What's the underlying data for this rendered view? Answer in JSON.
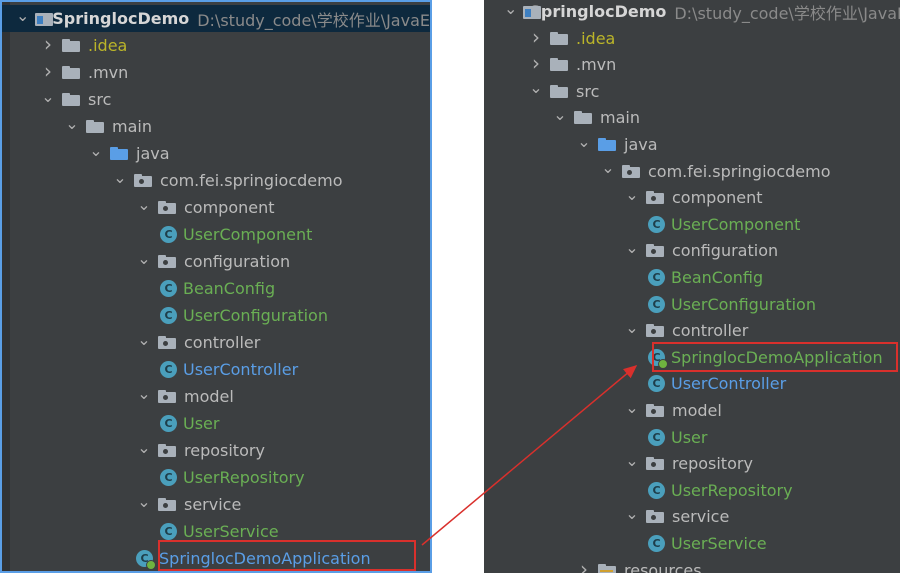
{
  "project": {
    "name": "SpringlocDemo",
    "path": "D:\\study_code\\学校作业\\JavaE"
  },
  "left_tree": [
    {
      "label": "SpringlocDemo",
      "type": "project",
      "depth": 0,
      "arrow": "down",
      "style": "bold"
    },
    {
      "label": ".idea",
      "type": "folder",
      "depth": 1,
      "arrow": "right",
      "style": "idea"
    },
    {
      "label": ".mvn",
      "type": "folder",
      "depth": 1,
      "arrow": "right"
    },
    {
      "label": "src",
      "type": "folder",
      "depth": 1,
      "arrow": "down"
    },
    {
      "label": "main",
      "type": "folder",
      "depth": 2,
      "arrow": "down"
    },
    {
      "label": "java",
      "type": "folder-blue",
      "depth": 3,
      "arrow": "down"
    },
    {
      "label": "com.fei.springiocdemo",
      "type": "package",
      "depth": 4,
      "arrow": "down"
    },
    {
      "label": "component",
      "type": "package",
      "depth": 5,
      "arrow": "down"
    },
    {
      "label": "UserComponent",
      "type": "class",
      "depth": 6,
      "style": "cls-text"
    },
    {
      "label": "configuration",
      "type": "package",
      "depth": 5,
      "arrow": "down"
    },
    {
      "label": "BeanConfig",
      "type": "class",
      "depth": 6,
      "style": "cls-text"
    },
    {
      "label": "UserConfiguration",
      "type": "class",
      "depth": 6,
      "style": "cls-text"
    },
    {
      "label": "controller",
      "type": "package",
      "depth": 5,
      "arrow": "down"
    },
    {
      "label": "UserController",
      "type": "class",
      "depth": 6,
      "style": "cls-blue"
    },
    {
      "label": "model",
      "type": "package",
      "depth": 5,
      "arrow": "down"
    },
    {
      "label": "User",
      "type": "class",
      "depth": 6,
      "style": "cls-text"
    },
    {
      "label": "repository",
      "type": "package",
      "depth": 5,
      "arrow": "down"
    },
    {
      "label": "UserRepository",
      "type": "class",
      "depth": 6,
      "style": "cls-text"
    },
    {
      "label": "service",
      "type": "package",
      "depth": 5,
      "arrow": "down"
    },
    {
      "label": "UserService",
      "type": "class",
      "depth": 6,
      "style": "cls-text"
    },
    {
      "label": "SpringlocDemoApplication",
      "type": "app-class",
      "depth": 5,
      "style": "cls-blue"
    }
  ],
  "right_tree": [
    {
      "label": "SpringlocDemo",
      "type": "project",
      "depth": 0,
      "arrow": "down",
      "style": "bold"
    },
    {
      "label": ".idea",
      "type": "folder",
      "depth": 1,
      "arrow": "right",
      "style": "idea"
    },
    {
      "label": ".mvn",
      "type": "folder",
      "depth": 1,
      "arrow": "right"
    },
    {
      "label": "src",
      "type": "folder",
      "depth": 1,
      "arrow": "down"
    },
    {
      "label": "main",
      "type": "folder",
      "depth": 2,
      "arrow": "down"
    },
    {
      "label": "java",
      "type": "folder-blue",
      "depth": 3,
      "arrow": "down"
    },
    {
      "label": "com.fei.springiocdemo",
      "type": "package",
      "depth": 4,
      "arrow": "down"
    },
    {
      "label": "component",
      "type": "package",
      "depth": 5,
      "arrow": "down"
    },
    {
      "label": "UserComponent",
      "type": "class",
      "depth": 6,
      "style": "cls-text"
    },
    {
      "label": "configuration",
      "type": "package",
      "depth": 5,
      "arrow": "down"
    },
    {
      "label": "BeanConfig",
      "type": "class",
      "depth": 6,
      "style": "cls-text"
    },
    {
      "label": "UserConfiguration",
      "type": "class",
      "depth": 6,
      "style": "cls-text"
    },
    {
      "label": "controller",
      "type": "package",
      "depth": 5,
      "arrow": "down"
    },
    {
      "label": "SpringlocDemoApplication",
      "type": "app-class",
      "depth": 6,
      "style": "cls-text"
    },
    {
      "label": "UserController",
      "type": "class",
      "depth": 6,
      "style": "cls-blue"
    },
    {
      "label": "model",
      "type": "package",
      "depth": 5,
      "arrow": "down"
    },
    {
      "label": "User",
      "type": "class",
      "depth": 6,
      "style": "cls-text"
    },
    {
      "label": "repository",
      "type": "package",
      "depth": 5,
      "arrow": "down"
    },
    {
      "label": "UserRepository",
      "type": "class",
      "depth": 6,
      "style": "cls-text"
    },
    {
      "label": "service",
      "type": "package",
      "depth": 5,
      "arrow": "down"
    },
    {
      "label": "UserService",
      "type": "class",
      "depth": 6,
      "style": "cls-text"
    },
    {
      "label": "resources",
      "type": "folder-resources",
      "depth": 3,
      "arrow": "right"
    }
  ],
  "colors": {
    "highlight": "#d9302c",
    "class_green": "#6aaf54",
    "class_blue": "#5a9ee6",
    "idea_yellow": "#bbb529",
    "panel_bg": "#3c3f41"
  }
}
